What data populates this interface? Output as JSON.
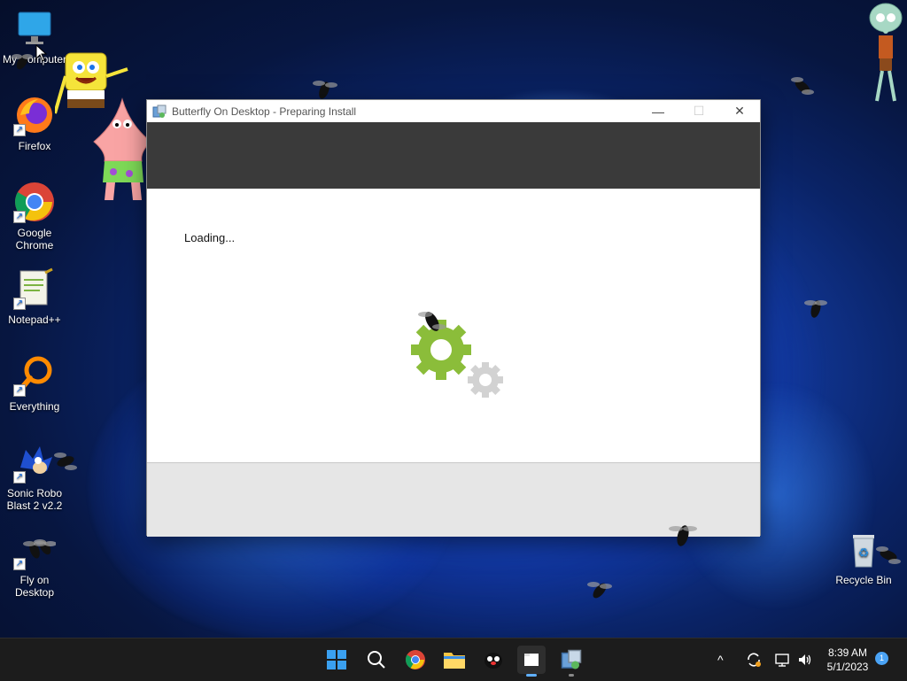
{
  "desktop": {
    "icons": [
      {
        "label": "My Computer"
      },
      {
        "label": "Firefox"
      },
      {
        "label": "Google Chrome"
      },
      {
        "label": "Notepad++"
      },
      {
        "label": "Everything"
      },
      {
        "label": "Sonic Robo Blast 2 v2.2"
      },
      {
        "label": "Fly on Desktop"
      },
      {
        "label": "Recycle Bin"
      }
    ]
  },
  "window": {
    "title": "Butterfly On Desktop - Preparing Install",
    "minimize": "—",
    "maximize": "☐",
    "close": "✕",
    "loading_text": "Loading..."
  },
  "taskbar": {
    "clock_time": "8:39 AM",
    "clock_date": "5/1/2023",
    "notification_count": "1",
    "tray_chevron": "^"
  },
  "colors": {
    "gear_green": "#8bbd3a",
    "gear_gray": "#d2d2d2",
    "banner": "#3a3a3a",
    "footer": "#e6e6e6"
  }
}
